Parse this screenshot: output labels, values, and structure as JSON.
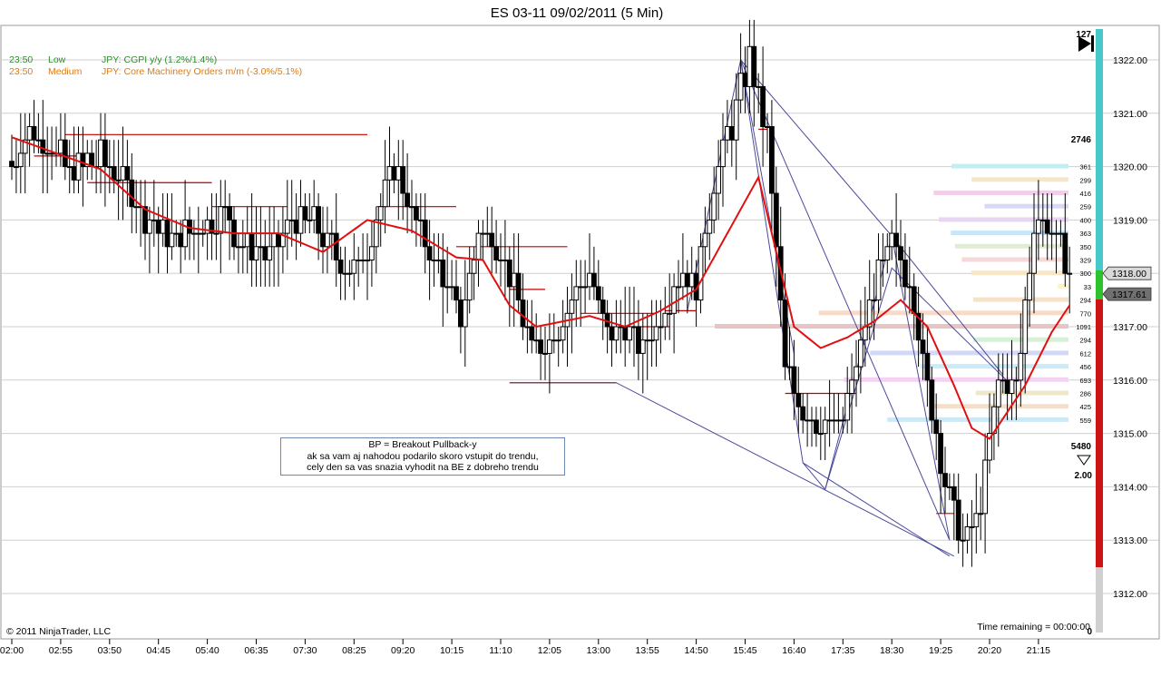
{
  "title": "ES 03-11  09/02/2011 (5 Min)",
  "copyright": "© 2011 NinjaTrader, LLC",
  "time_remaining": "Time remaining = 00:00:00",
  "news": [
    {
      "time": "23:50",
      "impact": "Low",
      "text": "JPY: CGPI y/y (1.2%/1.4%)",
      "color": "#2e8b2e"
    },
    {
      "time": "23:50",
      "impact": "Medium",
      "text": "JPY: Core Machinery Orders m/m (-3.0%/5.1%)",
      "color": "#e07b10"
    }
  ],
  "note": {
    "line1": "BP = Breakout Pullback-y",
    "line2": "ak sa vam aj nahodou podarilo skoro vstupit do trendu,",
    "line3": "cely den sa vas snazia vyhodit na BE z dobreho trendu"
  },
  "labels": {
    "bar_count": "127",
    "vol_top": "2746",
    "vol_bottom": "5480",
    "ratio": "2.00",
    "zero": "0",
    "last_price": "1318.00",
    "ema_price": "1317.61"
  },
  "colors": {
    "ema": "#e01010",
    "levels": "#c00000",
    "trendlines": "#4a4a9a",
    "up_body": "#ffffff",
    "down_body": "#000000",
    "grid": "#cfcfcf"
  },
  "chart_data": {
    "type": "candlestick",
    "title": "ES 03-11  09/02/2011 (5 Min)",
    "ylim": [
      1311.4,
      1322.4
    ],
    "y_ticks": [
      1312.0,
      1313.0,
      1314.0,
      1315.0,
      1316.0,
      1317.0,
      1318.0,
      1319.0,
      1320.0,
      1321.0,
      1322.0
    ],
    "x_ticks": [
      "02:00",
      "02:55",
      "03:50",
      "04:45",
      "05:40",
      "06:35",
      "07:30",
      "08:25",
      "09:20",
      "10:15",
      "11:10",
      "12:05",
      "13:00",
      "13:55",
      "14:50",
      "15:45",
      "16:40",
      "17:35",
      "18:30",
      "19:25",
      "20:20",
      "21:15"
    ],
    "bars_count": 239,
    "closes_anchor": [
      [
        0,
        1320.1
      ],
      [
        4,
        1320.6
      ],
      [
        9,
        1320.3
      ],
      [
        14,
        1319.9
      ],
      [
        20,
        1320.2
      ],
      [
        26,
        1319.7
      ],
      [
        30,
        1319.1
      ],
      [
        36,
        1318.6
      ],
      [
        42,
        1318.9
      ],
      [
        48,
        1319.1
      ],
      [
        52,
        1318.5
      ],
      [
        58,
        1318.4
      ],
      [
        63,
        1319.0
      ],
      [
        68,
        1319.0
      ],
      [
        74,
        1318.2
      ],
      [
        78,
        1318.0
      ],
      [
        82,
        1319.1
      ],
      [
        86,
        1320.0
      ],
      [
        89,
        1319.4
      ],
      [
        93,
        1318.6
      ],
      [
        97,
        1317.9
      ],
      [
        101,
        1317.1
      ],
      [
        105,
        1318.8
      ],
      [
        109,
        1318.6
      ],
      [
        113,
        1317.8
      ],
      [
        117,
        1316.6
      ],
      [
        121,
        1316.8
      ],
      [
        126,
        1317.4
      ],
      [
        130,
        1318.0
      ],
      [
        134,
        1316.8
      ],
      [
        138,
        1317.1
      ],
      [
        142,
        1316.6
      ],
      [
        146,
        1317.2
      ],
      [
        150,
        1318.0
      ],
      [
        154,
        1317.8
      ],
      [
        158,
        1319.8
      ],
      [
        162,
        1320.8
      ],
      [
        166,
        1322.0
      ],
      [
        170,
        1320.6
      ],
      [
        174,
        1316.2
      ],
      [
        178,
        1315.5
      ],
      [
        182,
        1315.2
      ],
      [
        186,
        1315.1
      ],
      [
        190,
        1316.2
      ],
      [
        194,
        1317.8
      ],
      [
        198,
        1318.6
      ],
      [
        202,
        1317.9
      ],
      [
        206,
        1315.9
      ],
      [
        210,
        1314.1
      ],
      [
        214,
        1313.0
      ],
      [
        218,
        1313.6
      ],
      [
        222,
        1316.0
      ],
      [
        226,
        1315.8
      ],
      [
        230,
        1319.0
      ],
      [
        233,
        1318.8
      ],
      [
        236,
        1318.4
      ],
      [
        238,
        1318.0
      ]
    ],
    "ema_anchor": [
      [
        0,
        1320.55
      ],
      [
        10,
        1320.25
      ],
      [
        20,
        1319.95
      ],
      [
        30,
        1319.2
      ],
      [
        40,
        1318.85
      ],
      [
        50,
        1318.75
      ],
      [
        60,
        1318.75
      ],
      [
        70,
        1318.4
      ],
      [
        80,
        1319.0
      ],
      [
        90,
        1318.8
      ],
      [
        100,
        1318.3
      ],
      [
        106,
        1318.25
      ],
      [
        112,
        1317.4
      ],
      [
        118,
        1317.0
      ],
      [
        124,
        1317.1
      ],
      [
        130,
        1317.2
      ],
      [
        138,
        1317.0
      ],
      [
        146,
        1317.3
      ],
      [
        154,
        1317.7
      ],
      [
        162,
        1318.9
      ],
      [
        168,
        1319.8
      ],
      [
        172,
        1318.4
      ],
      [
        176,
        1317.0
      ],
      [
        182,
        1316.6
      ],
      [
        188,
        1316.8
      ],
      [
        194,
        1317.1
      ],
      [
        200,
        1317.5
      ],
      [
        206,
        1317.0
      ],
      [
        212,
        1315.9
      ],
      [
        216,
        1315.1
      ],
      [
        220,
        1314.9
      ],
      [
        224,
        1315.4
      ],
      [
        228,
        1315.9
      ],
      [
        234,
        1316.9
      ],
      [
        238,
        1317.4
      ]
    ],
    "levels": [
      [
        0.8,
        0.8,
        1320.55
      ],
      [
        12,
        80,
        1320.6
      ],
      [
        5,
        18,
        1320.2
      ],
      [
        17,
        45,
        1319.7
      ],
      [
        45,
        62,
        1319.25
      ],
      [
        82,
        100,
        1319.25
      ],
      [
        100,
        125,
        1318.5
      ],
      [
        112,
        120,
        1317.7
      ],
      [
        112,
        136,
        1315.95
      ],
      [
        128,
        145,
        1317.25
      ],
      [
        138,
        148,
        1317.0
      ],
      [
        147,
        154,
        1317.3
      ],
      [
        168,
        170,
        1320.7
      ],
      [
        174,
        190,
        1315.75
      ],
      [
        208,
        212,
        1313.5
      ]
    ],
    "trendlines": [
      [
        [
          112,
          1315.95
        ],
        [
          136,
          1315.95
        ],
        [
          212,
          1312.7
        ]
      ],
      [
        [
          152,
          1317.3
        ],
        [
          164,
          1322.0
        ],
        [
          178,
          1314.45
        ],
        [
          183,
          1313.95
        ],
        [
          198,
          1318.7
        ],
        [
          223,
          1316.1
        ]
      ],
      [
        [
          164,
          1322.0
        ],
        [
          198,
          1318.7
        ],
        [
          211,
          1313.0
        ],
        [
          164,
          1322.0
        ]
      ],
      [
        [
          164,
          1322.0
        ],
        [
          176,
          1316.5
        ]
      ],
      [
        [
          178,
          1314.45
        ],
        [
          211,
          1312.7
        ]
      ],
      [
        [
          183,
          1313.95
        ],
        [
          198,
          1318.1
        ],
        [
          225,
          1315.9
        ]
      ]
    ],
    "volume_profile": [
      {
        "price": 1320.0,
        "volume": 361
      },
      {
        "price": 1319.75,
        "volume": 299
      },
      {
        "price": 1319.5,
        "volume": 416
      },
      {
        "price": 1319.25,
        "volume": 259
      },
      {
        "price": 1319.0,
        "volume": 400
      },
      {
        "price": 1318.75,
        "volume": 363
      },
      {
        "price": 1318.5,
        "volume": 350
      },
      {
        "price": 1318.25,
        "volume": 329
      },
      {
        "price": 1318.0,
        "volume": 300
      },
      {
        "price": 1317.75,
        "volume": 33
      },
      {
        "price": 1317.5,
        "volume": 294
      },
      {
        "price": 1317.25,
        "volume": 770
      },
      {
        "price": 1317.0,
        "volume": 1091
      },
      {
        "price": 1316.75,
        "volume": 294
      },
      {
        "price": 1316.5,
        "volume": 612
      },
      {
        "price": 1316.25,
        "volume": 456
      },
      {
        "price": 1316.0,
        "volume": 693
      },
      {
        "price": 1315.75,
        "volume": 286
      },
      {
        "price": 1315.5,
        "volume": 425
      },
      {
        "price": 1315.25,
        "volume": 559
      }
    ]
  }
}
